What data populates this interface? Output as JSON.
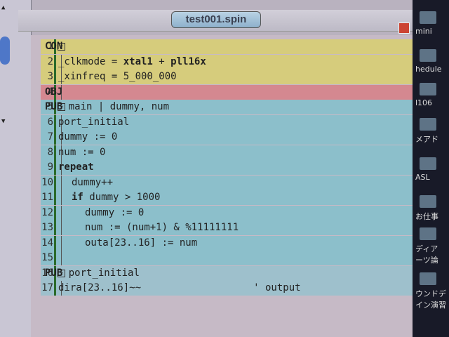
{
  "window": {
    "tab_title": "test001.spin"
  },
  "colors": {
    "con": "#d6cc7c",
    "obj": "#d48890",
    "pub": "#8cbfcb",
    "pub2": "#9ec0cc"
  },
  "lines": [
    {
      "n": "1",
      "fold": "−",
      "block": "con",
      "indent": 0,
      "segs": [
        {
          "t": "CON",
          "b": true
        }
      ]
    },
    {
      "n": "2",
      "block": "con",
      "indent": 2,
      "segs": [
        {
          "t": "_clkmode = "
        },
        {
          "t": "xtal1",
          "b": true
        },
        {
          "t": " + "
        },
        {
          "t": "pll16x",
          "b": true
        }
      ]
    },
    {
      "n": "3",
      "block": "con",
      "indent": 2,
      "segs": [
        {
          "t": "_xinfreq = 5_000_000"
        }
      ]
    },
    {
      "n": "4",
      "block": "obj",
      "indent": 0,
      "segs": [
        {
          "t": "OBJ",
          "b": true
        }
      ]
    },
    {
      "n": "5",
      "fold": "−",
      "block": "pub",
      "indent": 0,
      "segs": [
        {
          "t": "PUB",
          "b": true
        },
        {
          "t": " main | dummy, num"
        }
      ]
    },
    {
      "n": "6",
      "block": "pub",
      "indent": 2,
      "segs": [
        {
          "t": "port_initial"
        }
      ]
    },
    {
      "n": "7",
      "block": "pub",
      "indent": 2,
      "segs": [
        {
          "t": "dummy := 0"
        }
      ]
    },
    {
      "n": "8",
      "block": "pub",
      "indent": 2,
      "segs": [
        {
          "t": "num := 0"
        }
      ]
    },
    {
      "n": "9",
      "block": "pub",
      "indent": 2,
      "segs": [
        {
          "t": "repeat",
          "b": true
        }
      ]
    },
    {
      "n": "10",
      "block": "pub",
      "indent": 4,
      "segs": [
        {
          "t": "dummy++"
        }
      ]
    },
    {
      "n": "11",
      "block": "pub",
      "indent": 4,
      "segs": [
        {
          "t": "if",
          "b": true
        },
        {
          "t": " dummy > 1000"
        }
      ]
    },
    {
      "n": "12",
      "block": "pub",
      "indent": 6,
      "segs": [
        {
          "t": "dummy := 0"
        }
      ]
    },
    {
      "n": "13",
      "block": "pub",
      "indent": 6,
      "segs": [
        {
          "t": "num := (num+1) & %11111111"
        }
      ]
    },
    {
      "n": "14",
      "block": "pub",
      "indent": 6,
      "segs": [
        {
          "t": "outa[23..16] := num"
        }
      ]
    },
    {
      "n": "15",
      "block": "pub",
      "indent": 0,
      "segs": [
        {
          "t": ""
        }
      ]
    },
    {
      "n": "16",
      "fold": "−",
      "block": "pub2",
      "indent": 0,
      "segs": [
        {
          "t": "PUB",
          "b": true
        },
        {
          "t": " port_initial"
        }
      ]
    },
    {
      "n": "17",
      "block": "pub2",
      "indent": 2,
      "segs": [
        {
          "t": "dira[23..16]~~                   ' output"
        }
      ]
    }
  ],
  "desktop": {
    "items": [
      "mini",
      "hedule",
      "l106",
      "メアド",
      "ASL",
      "お仕事",
      "ディア\nーツ論",
      "ウンドデ\nイン演習"
    ]
  }
}
